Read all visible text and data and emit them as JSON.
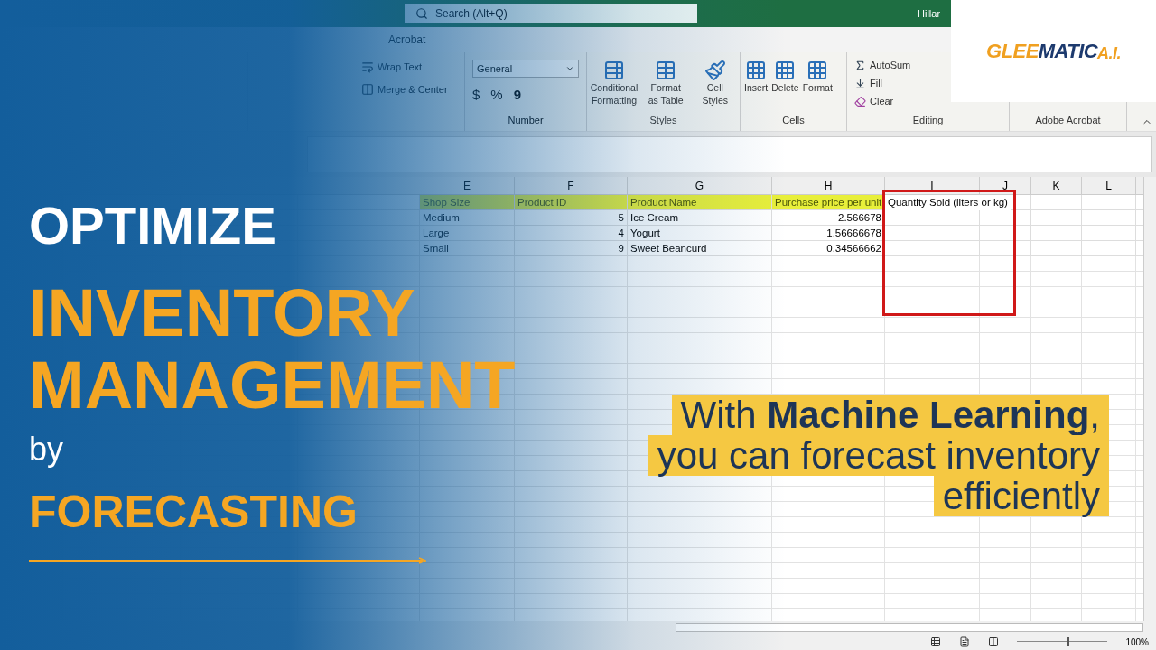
{
  "excel": {
    "search": {
      "placeholder": "Search (Alt+Q)"
    },
    "user": "Hillar",
    "tabs": [
      {
        "label": "Acrobat",
        "selected": false
      }
    ],
    "ribbon": {
      "alignment": {
        "wrap": "Wrap Text",
        "merge": "Merge & Center"
      },
      "number": {
        "format": "General",
        "currency": "$",
        "percent": "%",
        "comma": "9",
        "label": "Number"
      },
      "styles": {
        "items": [
          "Conditional Formatting",
          "Format as Table",
          "Cell Styles"
        ],
        "label": "Styles"
      },
      "cells": {
        "items": [
          "Insert",
          "Delete",
          "Format"
        ],
        "label": "Cells"
      },
      "editing": {
        "items": [
          "AutoSum",
          "Fill",
          "Clear"
        ],
        "label": "Editing"
      },
      "acrobat": {
        "label": "Adobe Acrobat"
      }
    },
    "columns": [
      "E",
      "F",
      "G",
      "H",
      "I",
      "J",
      "K",
      "L"
    ],
    "header_row": [
      {
        "text": "Shop Size",
        "highlighted": true
      },
      {
        "text": "Product ID",
        "highlighted": true
      },
      {
        "text": "Product Name",
        "highlighted": true
      },
      {
        "text": "Purchase price per unit",
        "highlighted": true
      },
      {
        "text": "Quantity Sold (liters or kg)",
        "highlighted": false
      }
    ],
    "rows": [
      [
        {
          "text": "Medium",
          "kind": "text"
        },
        {
          "text": "5",
          "kind": "number"
        },
        {
          "text": "Ice Cream",
          "kind": "text"
        },
        {
          "text": "2.566678",
          "kind": "number"
        }
      ],
      [
        {
          "text": "Large",
          "kind": "text"
        },
        {
          "text": "4",
          "kind": "number"
        },
        {
          "text": "Yogurt",
          "kind": "text"
        },
        {
          "text": "1.56666678",
          "kind": "number"
        }
      ],
      [
        {
          "text": "Small",
          "kind": "text"
        },
        {
          "text": "9",
          "kind": "number"
        },
        {
          "text": "Sweet Beancurd",
          "kind": "text"
        },
        {
          "text": "0.34566662",
          "kind": "number"
        }
      ]
    ],
    "zoom": {
      "level": 0.55,
      "value": "100%"
    }
  },
  "logo": {
    "parts": [
      {
        "text": "GLEE",
        "color": "#f0a020"
      },
      {
        "text": "MATIC",
        "color": "#1d3a6e"
      },
      {
        "text": "A.I.",
        "color": "#f0a020"
      }
    ]
  },
  "headline": [
    {
      "text": "OPTIMIZE",
      "kind": "white"
    },
    {
      "text": "INVENTORY",
      "kind": "large"
    },
    {
      "text": "MANAGEMENT",
      "kind": "large"
    },
    {
      "text": "by",
      "kind": "small"
    },
    {
      "text": "FORECASTING",
      "kind": "medium"
    }
  ],
  "callout": [
    "With **Machine Learning**,",
    "you can forecast inventory",
    "efficiently"
  ]
}
